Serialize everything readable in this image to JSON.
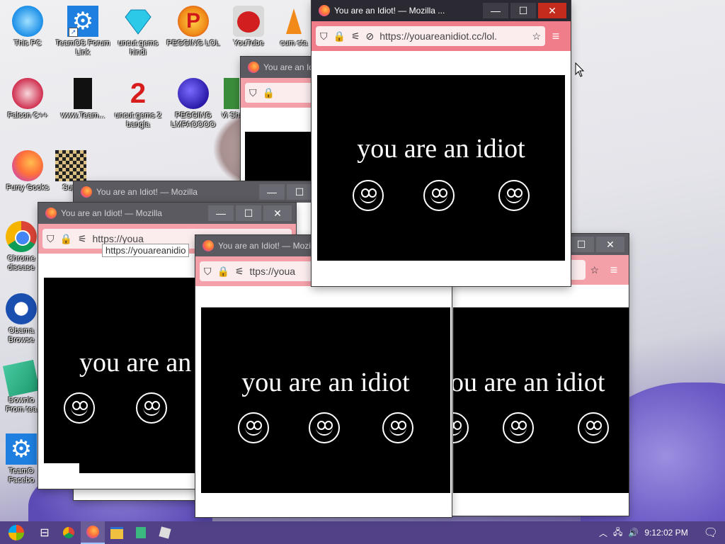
{
  "desktop_icons": [
    {
      "label": "This PC",
      "icon": "monitor-icon"
    },
    {
      "label": "TeamOS Forum Link",
      "icon": "gear-icon"
    },
    {
      "label": "uncut gems hindi",
      "icon": "diamond-icon"
    },
    {
      "label": "PEGGING LOL",
      "icon": "p-logo-icon"
    },
    {
      "label": "YouTube",
      "icon": "angry-bird-icon"
    },
    {
      "label": "cum sta",
      "icon": "cone-icon"
    },
    {
      "label": "Falcon C++",
      "icon": "recycle-icon"
    },
    {
      "label": "www.Team...",
      "icon": "book-icon"
    },
    {
      "label": "uncut gems 2 bangla",
      "icon": "number-2-icon"
    },
    {
      "label": "PEGGING LMFAOOOO",
      "icon": "orb-icon"
    },
    {
      "label": "Vi Shar",
      "icon": "app-icon"
    },
    {
      "label": "Furry Gooks",
      "icon": "firefox-icon"
    },
    {
      "label": "Sup",
      "icon": "pixel-icon"
    },
    {
      "label": "Chrome disease",
      "icon": "chrome-icon"
    },
    {
      "label": "Obama Browse",
      "icon": "obama-logo-icon"
    },
    {
      "label": "Downlo From tea",
      "icon": "download-icon"
    },
    {
      "label": "TeamO Facebo",
      "icon": "gear-icon"
    }
  ],
  "window": {
    "title": "You are an Idiot! — Mozilla ...",
    "title_bg": "You are an Idiot! — Mozilla",
    "title_bg2": "You are an Idiot! — Mozilla",
    "title_bg3": "You are an Idiot! — Mozilla",
    "url": "https://youareanidiot.cc/lol.",
    "url_short": "https://youa",
    "url_tooltip": "https://youareanidio",
    "url_mid": "ttps://youa",
    "controls": {
      "minimize": "—",
      "maximize": "☐",
      "close": "✕"
    },
    "message": "you are an idiot",
    "message_cut_left": "you are an",
    "message_cut_right": "ou are an idiot"
  },
  "taskbar": {
    "time": "9:12:02 PM",
    "items": [
      "start-icon",
      "task-view-icon",
      "chrome-icon",
      "firefox-icon",
      "file-explorer-icon",
      "notepad-icon",
      "roblox-icon"
    ]
  },
  "colors": {
    "urlbar": "#f07e8a",
    "titlebar": "#2b2a33",
    "close": "#c42b1c"
  }
}
